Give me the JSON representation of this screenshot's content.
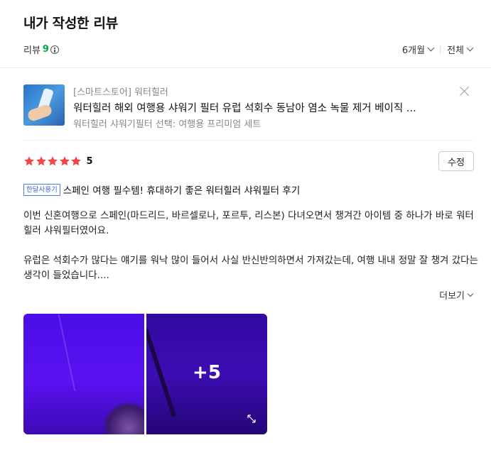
{
  "page": {
    "title": "내가 작성한 리뷰"
  },
  "summary": {
    "review_label": "리뷰",
    "review_count": "9",
    "filters": [
      {
        "label": "6개월"
      },
      {
        "label": "전체"
      }
    ]
  },
  "product": {
    "store": "[스마트스토어] 워터힐러",
    "name": "워터힐러 해외 여행용 샤워기 필터 유럽 석회수 동남아 염소 녹물 제거 베이직 ...",
    "option": "워터힐러 샤워기필터 선택: 여행용 프리미엄 세트"
  },
  "review": {
    "rating": 5,
    "rating_label": "5",
    "edit_label": "수정",
    "badge": "한달사용기",
    "headline": "스페인 여행 필수템! 휴대하기 좋은 워터힐러 샤워필터 후기",
    "paragraphs": [
      "이번 신혼여행으로 스페인(마드리드, 바르셀로나, 포르투, 리스본) 다녀오면서 챙겨간 아이템 중 하나가 바로 워터힐러 샤워필터였어요.",
      "유럽은 석회수가 많다는 얘기를 워낙 많이 들어서 사실 반신반의하면서 가져갔는데, 여행 내내 정말 잘 챙겨 갔다는 생각이 들었습니다...."
    ],
    "more_label": "더보기",
    "photos_more_count": "+5"
  },
  "colors": {
    "star": "#f04848",
    "count_green": "#03a94d",
    "badge_blue": "#3866d9"
  }
}
